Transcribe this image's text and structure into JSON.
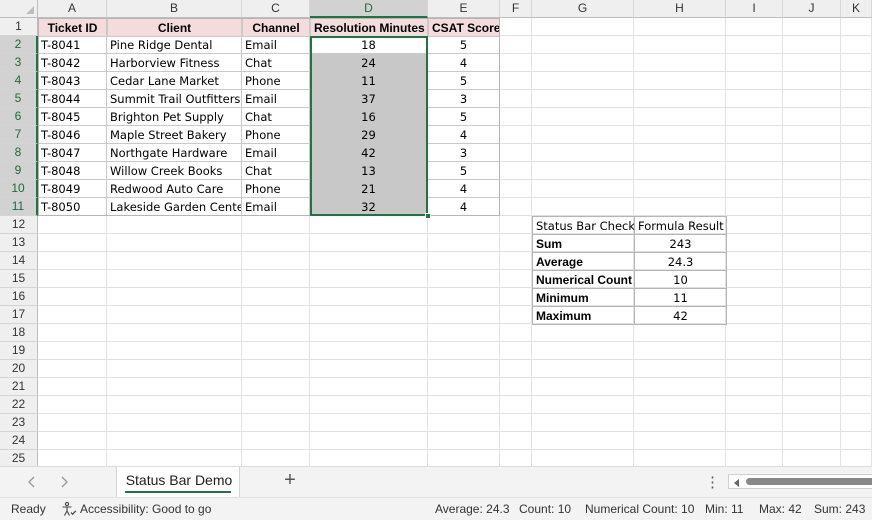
{
  "columns": [
    "A",
    "B",
    "C",
    "D",
    "E",
    "F",
    "G",
    "H",
    "I",
    "J",
    "K"
  ],
  "rows": [
    "1",
    "2",
    "3",
    "4",
    "5",
    "6",
    "7",
    "8",
    "9",
    "10",
    "11",
    "12",
    "13",
    "14",
    "15",
    "16",
    "17",
    "18",
    "19",
    "20",
    "21",
    "22",
    "23",
    "24",
    "25"
  ],
  "table": {
    "headers": [
      "Ticket ID",
      "Client",
      "Channel",
      "Resolution Minutes",
      "CSAT Score"
    ],
    "rows": [
      [
        "T-8041",
        "Pine Ridge Dental",
        "Email",
        "18",
        "5"
      ],
      [
        "T-8042",
        "Harborview Fitness",
        "Chat",
        "24",
        "4"
      ],
      [
        "T-8043",
        "Cedar Lane Market",
        "Phone",
        "11",
        "5"
      ],
      [
        "T-8044",
        "Summit Trail Outfitters",
        "Email",
        "37",
        "3"
      ],
      [
        "T-8045",
        "Brighton Pet Supply",
        "Chat",
        "16",
        "5"
      ],
      [
        "T-8046",
        "Maple Street Bakery",
        "Phone",
        "29",
        "4"
      ],
      [
        "T-8047",
        "Northgate Hardware",
        "Email",
        "42",
        "3"
      ],
      [
        "T-8048",
        "Willow Creek Books",
        "Chat",
        "13",
        "5"
      ],
      [
        "T-8049",
        "Redwood Auto Care",
        "Phone",
        "21",
        "4"
      ],
      [
        "T-8050",
        "Lakeside Garden Center",
        "Email",
        "32",
        "4"
      ]
    ]
  },
  "check": {
    "headers": [
      "Status Bar Check",
      "Formula Result"
    ],
    "rows": [
      [
        "Sum",
        "243"
      ],
      [
        "Average",
        "24.3"
      ],
      [
        "Numerical Count",
        "10"
      ],
      [
        "Minimum",
        "11"
      ],
      [
        "Maximum",
        "42"
      ]
    ]
  },
  "tabs": {
    "active_sheet": "Status Bar Demo",
    "add_label": "+",
    "more_label": "⋮"
  },
  "status": {
    "ready": "Ready",
    "accessibility": "Accessibility: Good to go",
    "average": "Average: 24.3",
    "count": "Count: 10",
    "numerical_count": "Numerical Count: 10",
    "min": "Min: 11",
    "max": "Max: 42",
    "sum": "Sum: 243"
  },
  "colors": {
    "accent": "#217346",
    "header_fill": "#f4dcdc",
    "selection_fill": "#c8c8c8"
  },
  "icons": {
    "accessibility": "accessibility-icon",
    "prev": "chevron-left-icon",
    "next": "chevron-right-icon"
  }
}
